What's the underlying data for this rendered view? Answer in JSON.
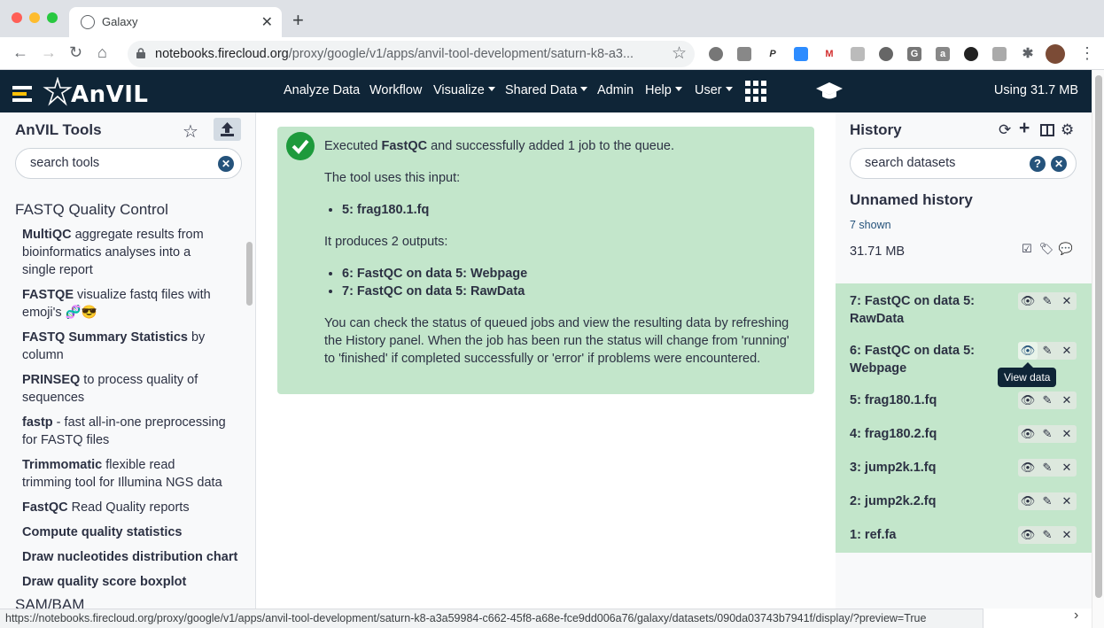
{
  "browser": {
    "tab_title": "Galaxy",
    "url_host": "notebooks.firecloud.org",
    "url_path": "/proxy/google/v1/apps/anvil-tool-development/saturn-k8-a3...",
    "status_url": "https://notebooks.firecloud.org/proxy/google/v1/apps/anvil-tool-development/saturn-k8-a3a59984-c662-45f8-a68e-fce9dd006a76/galaxy/datasets/090da03743b7941f/display/?preview=True"
  },
  "masthead": {
    "brand": "AnVIL",
    "menu": [
      {
        "label": "Analyze Data"
      },
      {
        "label": "Workflow"
      },
      {
        "label": "Visualize"
      },
      {
        "label": "Shared Data"
      },
      {
        "label": "Admin"
      },
      {
        "label": "Help"
      },
      {
        "label": "User"
      }
    ],
    "quota": "Using 31.7 MB"
  },
  "tools": {
    "title": "AnVIL Tools",
    "search_placeholder": "search tools",
    "section": "FASTQ Quality Control",
    "items": [
      {
        "name": "MultiQC",
        "desc": " aggregate results from bioinformatics analyses into a single report"
      },
      {
        "name": "FASTQE",
        "desc": " visualize fastq files with emoji's 🧬😎"
      },
      {
        "name": "FASTQ Summary Statistics",
        "desc": " by column"
      },
      {
        "name": "PRINSEQ",
        "desc": " to process quality of sequences"
      },
      {
        "name": "fastp",
        "desc": " - fast all-in-one preprocessing for FASTQ files"
      },
      {
        "name": "Trimmomatic",
        "desc": " flexible read trimming tool for Illumina NGS data"
      },
      {
        "name": "FastQC",
        "desc": " Read Quality reports"
      },
      {
        "name": "Compute quality statistics",
        "desc": ""
      },
      {
        "name": "Draw nucleotides distribution chart",
        "desc": ""
      },
      {
        "name": "Draw quality score boxplot",
        "desc": ""
      }
    ],
    "next_section": "SAM/BAM"
  },
  "message": {
    "pre": "Executed ",
    "tool": "FastQC",
    "post": " and successfully added 1 job to the queue.",
    "input_intro": "The tool uses this input:",
    "inputs": [
      "5: frag180.1.fq"
    ],
    "output_intro": "It produces 2 outputs:",
    "outputs": [
      "6: FastQC on data 5: Webpage",
      "7: FastQC on data 5: RawData"
    ],
    "note": "You can check the status of queued jobs and view the resulting data by refreshing the History panel. When the job has been run the status will change from 'running' to 'finished' if completed successfully or 'error' if problems were encountered."
  },
  "history": {
    "title": "History",
    "search_placeholder": "search datasets",
    "name": "Unnamed history",
    "shown": "7 shown",
    "size": "31.71 MB",
    "items": [
      {
        "label": "7: FastQC on data 5: RawData"
      },
      {
        "label": "6: FastQC on data 5: Webpage"
      },
      {
        "label": "5: frag180.1.fq"
      },
      {
        "label": "4: frag180.2.fq"
      },
      {
        "label": "3: jump2k.1.fq"
      },
      {
        "label": "2: jump2k.2.fq"
      },
      {
        "label": "1: ref.fa"
      }
    ],
    "tooltip": "View data"
  },
  "colors": {
    "masthead": "#0f2537",
    "success_bg": "#c3e6cb",
    "check": "#1d9a3c",
    "accent": "#25537b"
  },
  "icons": [
    "star-icon",
    "upload-icon",
    "clear-search-icon",
    "refresh-icon",
    "plus-icon",
    "columns-icon",
    "gear-icon",
    "help-icon",
    "eye-icon",
    "pencil-icon",
    "delete-icon",
    "check-icon",
    "apps-grid-icon",
    "graduation-cap-icon"
  ]
}
